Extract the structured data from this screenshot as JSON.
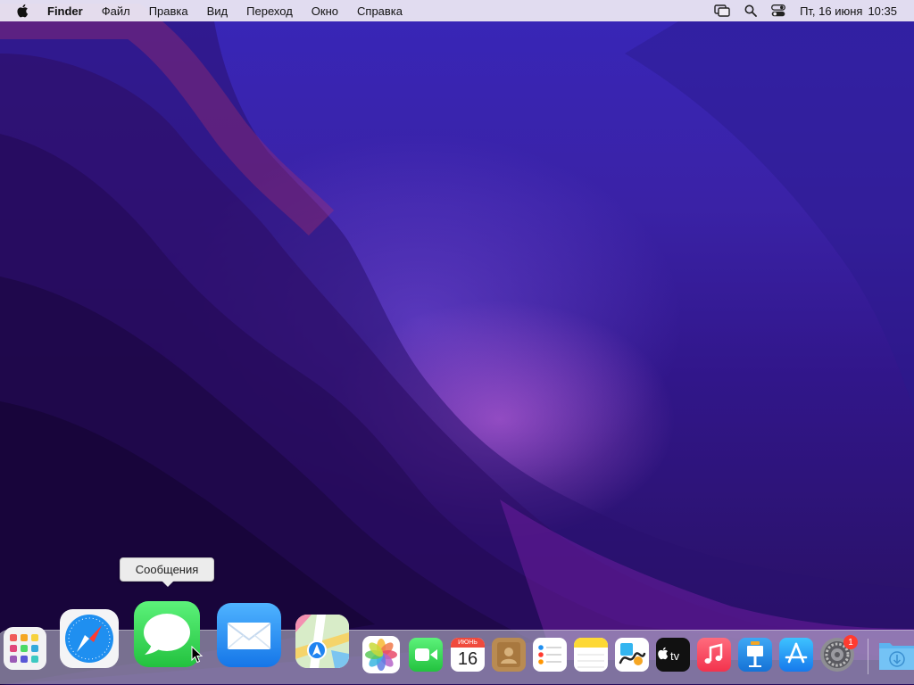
{
  "menubar": {
    "app_name": "Finder",
    "menu_items": [
      "Файл",
      "Правка",
      "Вид",
      "Переход",
      "Окно",
      "Справка"
    ],
    "clock": {
      "date": "Пт, 16 июня",
      "time": "10:35"
    }
  },
  "tooltip": {
    "text": "Сообщения"
  },
  "dock": {
    "items": [
      {
        "name": "Launchpad",
        "icon": "launchpad-icon"
      },
      {
        "name": "Safari",
        "icon": "safari-icon"
      },
      {
        "name": "Сообщения",
        "icon": "messages-icon"
      },
      {
        "name": "Mail",
        "icon": "mail-icon"
      },
      {
        "name": "Карты",
        "icon": "maps-icon"
      },
      {
        "name": "Фото",
        "icon": "photos-icon"
      },
      {
        "name": "FaceTime",
        "icon": "facetime-icon"
      },
      {
        "name": "Календарь",
        "icon": "calendar-icon",
        "month": "ИЮНЬ",
        "day": "16"
      },
      {
        "name": "Контакты",
        "icon": "contacts-icon"
      },
      {
        "name": "Напоминания",
        "icon": "reminders-icon"
      },
      {
        "name": "Заметки",
        "icon": "notes-icon"
      },
      {
        "name": "Freeform",
        "icon": "freeform-icon"
      },
      {
        "name": "TV",
        "icon": "tv-icon",
        "label": "tv"
      },
      {
        "name": "Музыка",
        "icon": "music-icon"
      },
      {
        "name": "Keynote",
        "icon": "keynote-icon"
      },
      {
        "name": "App Store",
        "icon": "appstore-icon"
      },
      {
        "name": "Системные настройки",
        "icon": "settings-icon",
        "badge": "1"
      },
      {
        "name": "Загрузки",
        "icon": "downloads-folder-icon"
      }
    ]
  },
  "colors": {
    "menubar_bg": "#f0ecf4",
    "badge": "#ff3b30",
    "messages_green": "#34c759",
    "mail_blue": "#1e8cf5"
  }
}
